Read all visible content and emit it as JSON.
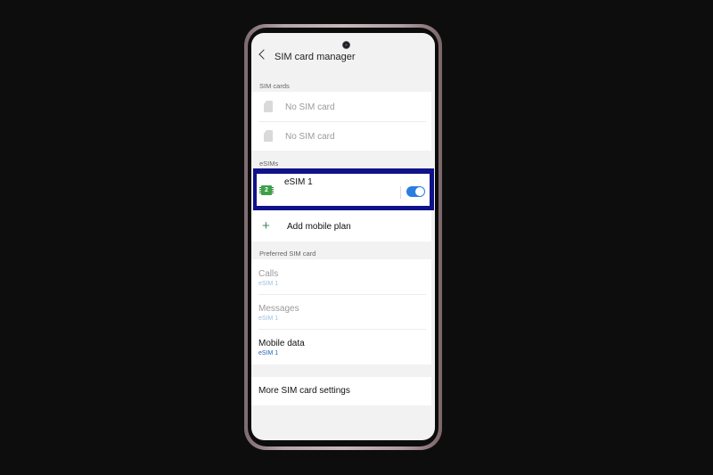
{
  "header": {
    "title": "SIM card manager"
  },
  "sim_cards": {
    "label": "SIM cards",
    "items": [
      {
        "label": "No SIM card"
      },
      {
        "label": "No SIM card"
      }
    ]
  },
  "esims": {
    "label": "eSIMs",
    "items": [
      {
        "name": "eSIM 1",
        "chip_number": "2",
        "enabled": true
      }
    ],
    "add_label": "Add mobile plan"
  },
  "preferred": {
    "label": "Preferred SIM card",
    "items": [
      {
        "title": "Calls",
        "value": "eSIM 1"
      },
      {
        "title": "Messages",
        "value": "eSIM 1"
      },
      {
        "title": "Mobile data",
        "value": "eSIM 1"
      }
    ]
  },
  "more_settings": {
    "label": "More SIM card settings"
  },
  "colors": {
    "highlight": "#10128a",
    "toggle_on": "#2a7de1",
    "chip": "#3fa04a",
    "value_blue": "#2563b8"
  }
}
